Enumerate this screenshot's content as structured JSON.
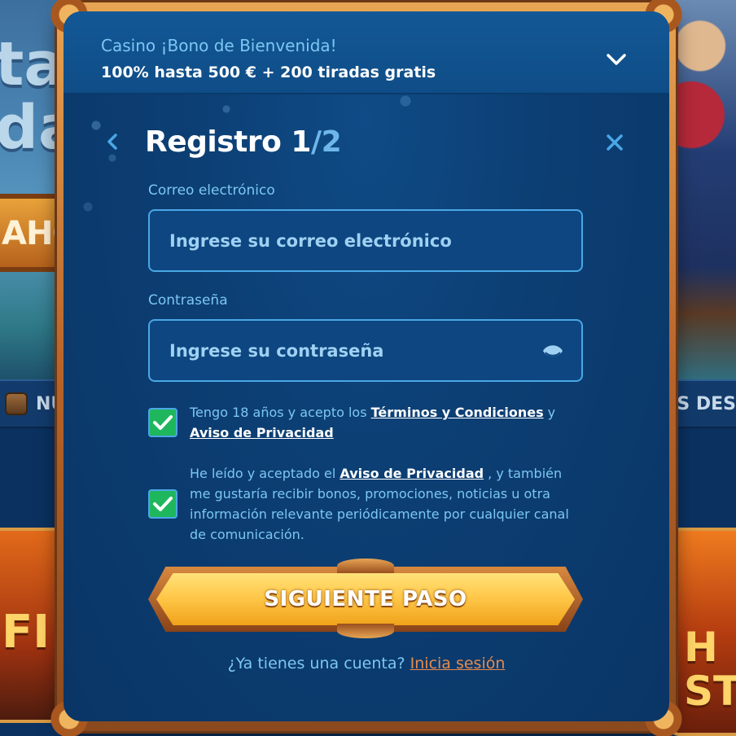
{
  "background": {
    "left_text": "ta\ndas",
    "left_banner": "AHO",
    "nav_left": "NU",
    "nav_right": "GOS DES",
    "tile_left": "FI",
    "tile_right": "H\nST"
  },
  "promo": {
    "title": "Casino ¡Bono de Bienvenida!",
    "subtitle": "100% hasta 500 € + 200 tiradas gratis"
  },
  "header": {
    "title_main": "Registro 1",
    "title_sep": "/2"
  },
  "email": {
    "label": "Correo electrónico",
    "placeholder": "Ingrese su correo electrónico",
    "value": ""
  },
  "password": {
    "label": "Contraseña",
    "placeholder": "Ingrese su contraseña",
    "value": ""
  },
  "consent_terms": {
    "checked": true,
    "text_before": "Tengo 18 años y acepto los ",
    "link_terms": "Términos y Condiciones",
    "text_mid": " y ",
    "link_privacy": "Aviso de Privacidad"
  },
  "consent_marketing": {
    "checked": true,
    "text_before": "He leído y aceptado el ",
    "link_privacy": "Aviso de Privacidad",
    "text_after": " , y también me gustaría recibir bonos, promociones, noticias u otra información relevante periódicamente por cualquier canal de comunicación."
  },
  "cta": {
    "label": "SIGUIENTE PASO"
  },
  "login": {
    "prompt": "¿Ya tienes una cuenta?",
    "link": "Inicia sesión"
  },
  "colors": {
    "accent": "#7cc7f2",
    "cta": "#ffc84a",
    "checkbox": "#1fb75d",
    "login_link": "#e88a4a"
  }
}
